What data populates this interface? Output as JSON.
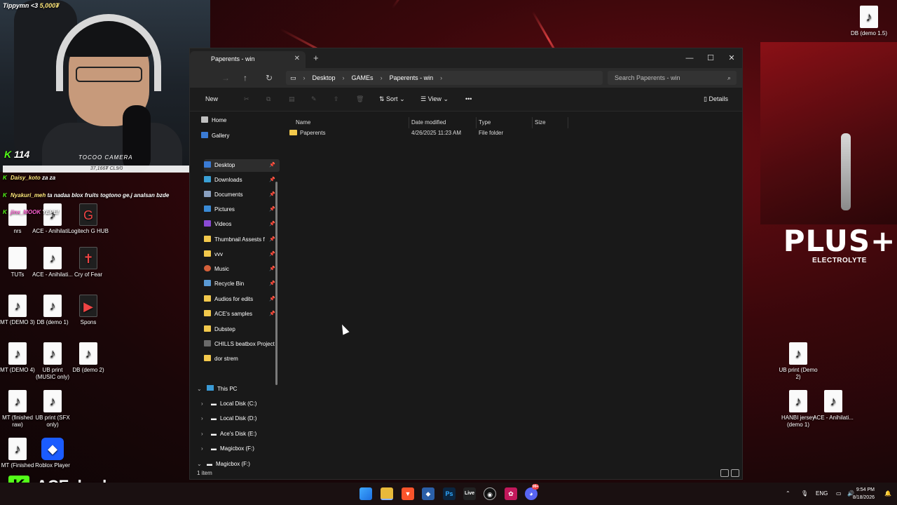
{
  "overlay": {
    "streamer_label": "Tippymn <3",
    "streamer_coins": "5,000₮",
    "viewer_count": "114",
    "camera_label": "TOCOO CAMERA",
    "sub_goal": "37,166₮ CL9/0",
    "chat": [
      {
        "user": "Daisy_koto",
        "message": "za za"
      },
      {
        "user": "Nyakuri_meh",
        "message": "ta nadaa blox fruits togtono ge.j analsan bzde"
      },
      {
        "user": "jinx_MOOK",
        "message": "YEPE!"
      }
    ],
    "brand_name": "ACE_bruh",
    "brand_logo": "K",
    "kick_color": "#53fc18"
  },
  "desktop": {
    "icons_left": [
      {
        "label": "nrs",
        "icon": "file-icon"
      },
      {
        "label": "ACE - Anihilati...",
        "icon": "music-file-icon"
      },
      {
        "label": "Logitech G HUB",
        "icon": "logitech-icon"
      },
      {
        "label": "TUTs",
        "icon": "file-icon"
      },
      {
        "label": "ACE - Anihilati...",
        "icon": "music-file-icon"
      },
      {
        "label": "Cry of Fear",
        "icon": "game-icon"
      },
      {
        "label": "MT (DEMO 3)",
        "icon": "music-file-icon"
      },
      {
        "label": "DB (demo 1)",
        "icon": "music-file-icon"
      },
      {
        "label": "Spons",
        "icon": "video-file-icon"
      },
      {
        "label": "MT (DEMO 4)",
        "icon": "music-file-icon"
      },
      {
        "label": "UB print (MUSIC only)",
        "icon": "music-file-icon"
      },
      {
        "label": "DB (demo 2)",
        "icon": "music-file-icon"
      },
      {
        "label": "MT (finished raw)",
        "icon": "music-file-icon"
      },
      {
        "label": "UB print (SFX only)",
        "icon": "music-file-icon"
      },
      {
        "label": "MT (Finished",
        "icon": "music-file-icon"
      },
      {
        "label": "Roblox Player",
        "icon": "roblox-icon"
      }
    ],
    "icons_right": [
      {
        "label": "DB (demo 1.5)",
        "icon": "music-file-icon"
      },
      {
        "label": "UB print (Demo 2)",
        "icon": "music-file-icon"
      },
      {
        "label": "HANBI jersey (demo 1)",
        "icon": "music-file-icon"
      },
      {
        "label": "ACE - Anihilati...",
        "icon": "music-file-icon"
      }
    ],
    "wallpaper_brand": "PLUS+",
    "wallpaper_tagline": "ELECTROLYTE",
    "wallpaper_color": "#6a0c12"
  },
  "explorer": {
    "tab_title": "Paperents - win",
    "breadcrumb": [
      "Desktop",
      "GAMEs",
      "Paperents - win"
    ],
    "search_placeholder": "Search Paperents - win",
    "commands": {
      "new": "New",
      "sort": "Sort",
      "view": "View",
      "more": "•••",
      "details": "Details"
    },
    "sidebar": {
      "top": [
        "Home",
        "Gallery"
      ],
      "pinned": [
        {
          "label": "Desktop",
          "icon": "desktop-icon",
          "color": "#3a7bd5"
        },
        {
          "label": "Downloads",
          "icon": "download-icon",
          "color": "#3aa0d5"
        },
        {
          "label": "Documents",
          "icon": "document-icon",
          "color": "#8aa0c0"
        },
        {
          "label": "Pictures",
          "icon": "pictures-icon",
          "color": "#3a8ad5"
        },
        {
          "label": "Videos",
          "icon": "videos-icon",
          "color": "#8a4ad5"
        },
        {
          "label": "Thumbnail Assests f",
          "icon": "folder-icon",
          "color": "#f3c94c"
        },
        {
          "label": "vvv",
          "icon": "folder-icon",
          "color": "#f3c94c"
        },
        {
          "label": "Music",
          "icon": "music-icon",
          "color": "#d5603a"
        },
        {
          "label": "Recycle Bin",
          "icon": "recycle-bin-icon",
          "color": "#5a9ad5"
        },
        {
          "label": "Audios for edits",
          "icon": "folder-icon",
          "color": "#f3c94c"
        },
        {
          "label": "ACE's samples",
          "icon": "folder-icon",
          "color": "#f3c94c"
        },
        {
          "label": "Dubstep",
          "icon": "folder-icon",
          "color": "#f3c94c"
        },
        {
          "label": "CHILLS beatbox Project",
          "icon": "file-icon",
          "color": "#6a6a6a"
        },
        {
          "label": "dor strem",
          "icon": "folder-icon",
          "color": "#f3c94c"
        }
      ],
      "this_pc": "This PC",
      "drives": [
        "Local Disk (C:)",
        "Local Disk (D:)",
        "Ace's Disk (E:)",
        "Magicbox (F:)",
        "Magicbox (F:)"
      ]
    },
    "columns": [
      "Name",
      "Date modified",
      "Type",
      "Size"
    ],
    "rows": [
      {
        "name": "Paperents",
        "date": "4/26/2025 11:23 AM",
        "type": "File folder",
        "size": ""
      }
    ],
    "status": "1 item"
  },
  "taskbar": {
    "apps": [
      "start",
      "file-explorer",
      "brave",
      "app-blue",
      "photoshop",
      "live",
      "obs",
      "app-pink",
      "discord"
    ],
    "tray_lang": "ENG",
    "time": "9:54 PM",
    "date": "8/18/2026",
    "discord_badge": "99+"
  }
}
